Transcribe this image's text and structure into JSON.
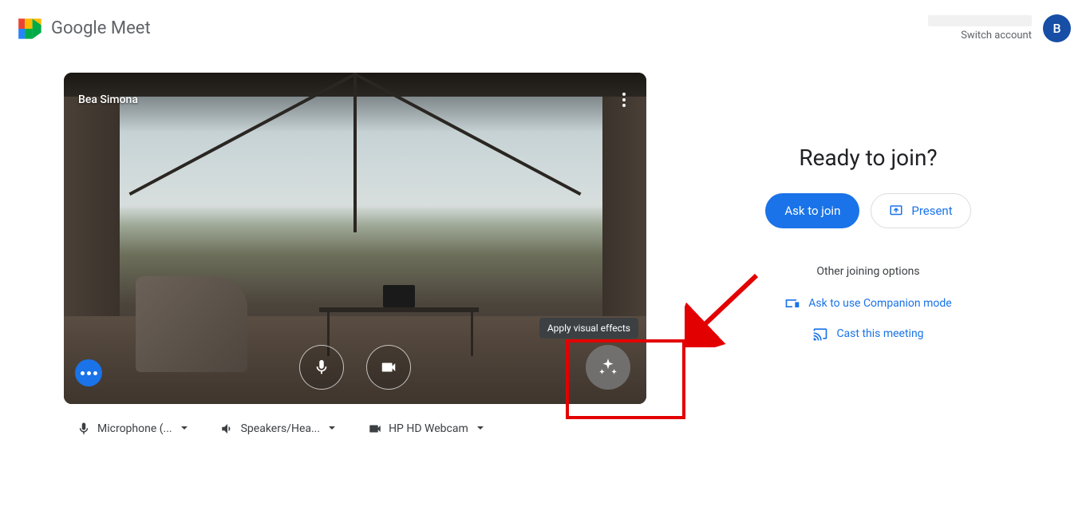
{
  "header": {
    "product": "Google Meet",
    "switch_account": "Switch account",
    "avatar_initial": "B"
  },
  "preview": {
    "participant_name": "Bea Simona",
    "tooltip": "Apply visual effects"
  },
  "devices": {
    "mic": "Microphone (...",
    "speaker": "Speakers/Hea...",
    "camera": "HP HD Webcam"
  },
  "join": {
    "heading": "Ready to join?",
    "ask": "Ask to join",
    "present": "Present",
    "other_title": "Other joining options",
    "companion": "Ask to use Companion mode",
    "cast": "Cast this meeting"
  }
}
